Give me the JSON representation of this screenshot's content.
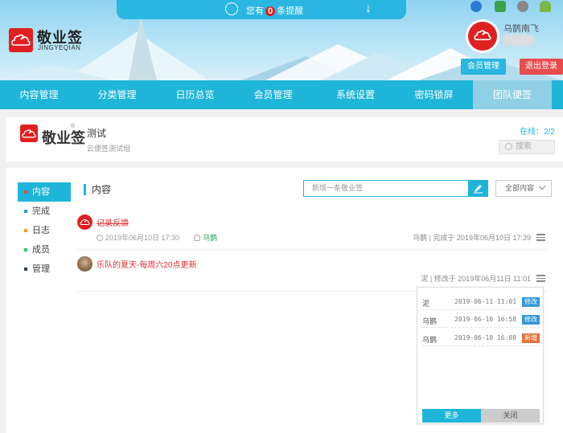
{
  "header": {
    "brand_name": "敬业签",
    "brand_sub": "JINGYEQIAN",
    "notice_prefix": "您有",
    "notice_count": "0",
    "notice_suffix": "条提醒",
    "username": "乌鹊南飞",
    "member_button": "会员管理",
    "logout_button": "退出登录",
    "os_icons": [
      "ie-icon",
      "windows-icon",
      "apple-icon",
      "android-icon"
    ]
  },
  "nav": {
    "items": [
      "内容管理",
      "分类管理",
      "日历总览",
      "会员管理",
      "系统设置",
      "密码锁屏",
      "团队便签"
    ],
    "active_index": 6
  },
  "group": {
    "logo_text": "敬业签",
    "title": "测试",
    "description": "云便签测试组",
    "online_label": "在线：2/2",
    "search_placeholder": "搜索"
  },
  "sidebar": {
    "items": [
      {
        "label": "内容",
        "color": "#e74c3c"
      },
      {
        "label": "完成",
        "color": "#3498db"
      },
      {
        "label": "日志",
        "color": "#f39c12"
      },
      {
        "label": "成员",
        "color": "#2ecc71"
      },
      {
        "label": "管理",
        "color": "#2c3e50"
      }
    ],
    "active_index": 0
  },
  "content": {
    "section_title": "内容",
    "new_placeholder": "新增一条敬业签",
    "filter_label": "全部内容",
    "notes": [
      {
        "title": "记录反馈",
        "completed": true,
        "time": "2019年06月10日 17:30",
        "assignee": "乌鹊",
        "status": "乌鹊 | 完成于 2019年06月10日 17:39"
      },
      {
        "title": "乐队的夏天-每周六20点更新",
        "completed": false,
        "status": "泥 | 修改于 2019年06月11日 11:01"
      }
    ]
  },
  "history_popup": {
    "rows": [
      {
        "who": "泥",
        "when": "2019-06-11 11:01",
        "tag": "修改",
        "tag_color": "#3498db"
      },
      {
        "who": "乌鹊",
        "when": "2019-06-10 16:58",
        "tag": "修改",
        "tag_color": "#3498db"
      },
      {
        "who": "乌鹊",
        "when": "2019-06-10 16:08",
        "tag": "新增",
        "tag_color": "#e8703a"
      }
    ],
    "more_label": "更多",
    "close_label": "关闭"
  }
}
